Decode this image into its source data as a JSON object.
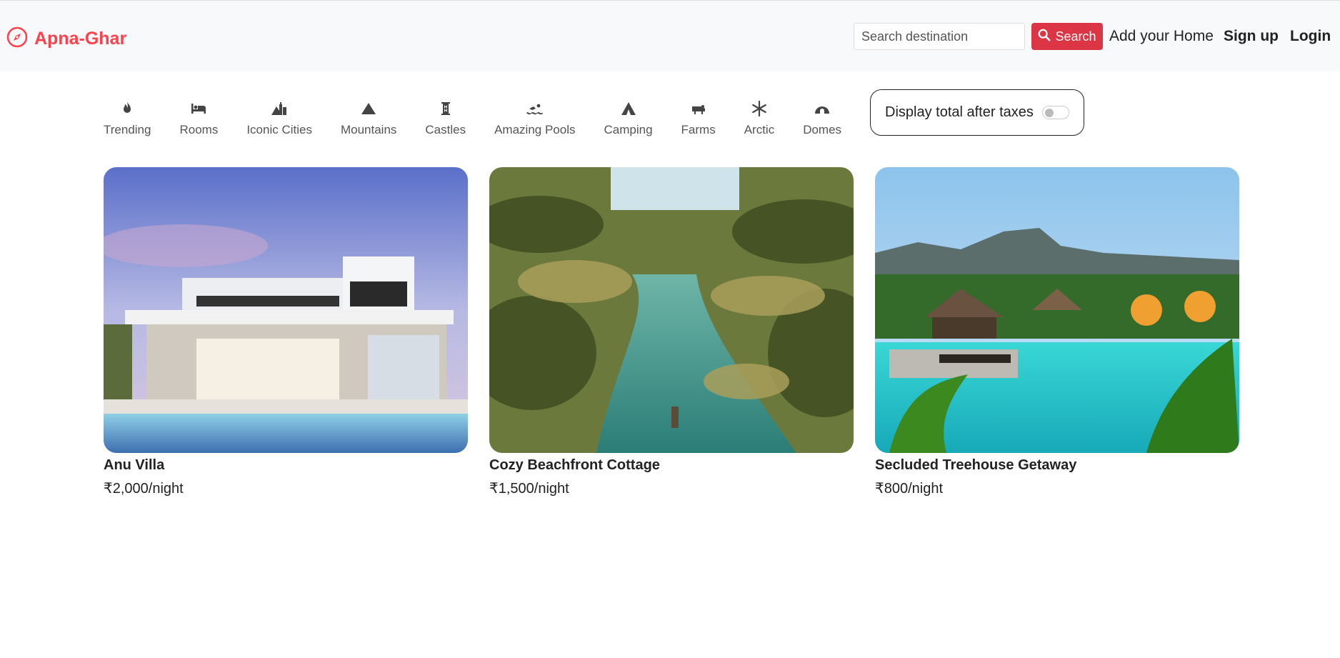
{
  "navbar": {
    "brand": "Apna-Ghar",
    "search_placeholder": "Search destination",
    "search_button": "Search",
    "add_home": "Add your Home",
    "signup": "Sign up",
    "login": "Login",
    "brand_color": "#fe424d"
  },
  "filters": [
    {
      "label": "Trending",
      "icon": "fire-icon"
    },
    {
      "label": "Rooms",
      "icon": "bed-icon"
    },
    {
      "label": "Iconic Cities",
      "icon": "mountain-city-icon"
    },
    {
      "label": "Mountains",
      "icon": "mountain-icon"
    },
    {
      "label": "Castles",
      "icon": "castle-icon"
    },
    {
      "label": "Amazing Pools",
      "icon": "person-swimming-icon"
    },
    {
      "label": "Camping",
      "icon": "campground-icon"
    },
    {
      "label": "Farms",
      "icon": "cow-icon"
    },
    {
      "label": "Arctic",
      "icon": "snowflake-icon"
    },
    {
      "label": "Domes",
      "icon": "igloo-icon"
    }
  ],
  "tax_toggle": {
    "label": "Display total after taxes",
    "enabled": false
  },
  "listings": [
    {
      "title": "Anu Villa",
      "price": "₹2,000/night"
    },
    {
      "title": "Cozy Beachfront Cottage",
      "price": "₹1,500/night"
    },
    {
      "title": "Secluded Treehouse Getaway",
      "price": "₹800/night"
    }
  ]
}
